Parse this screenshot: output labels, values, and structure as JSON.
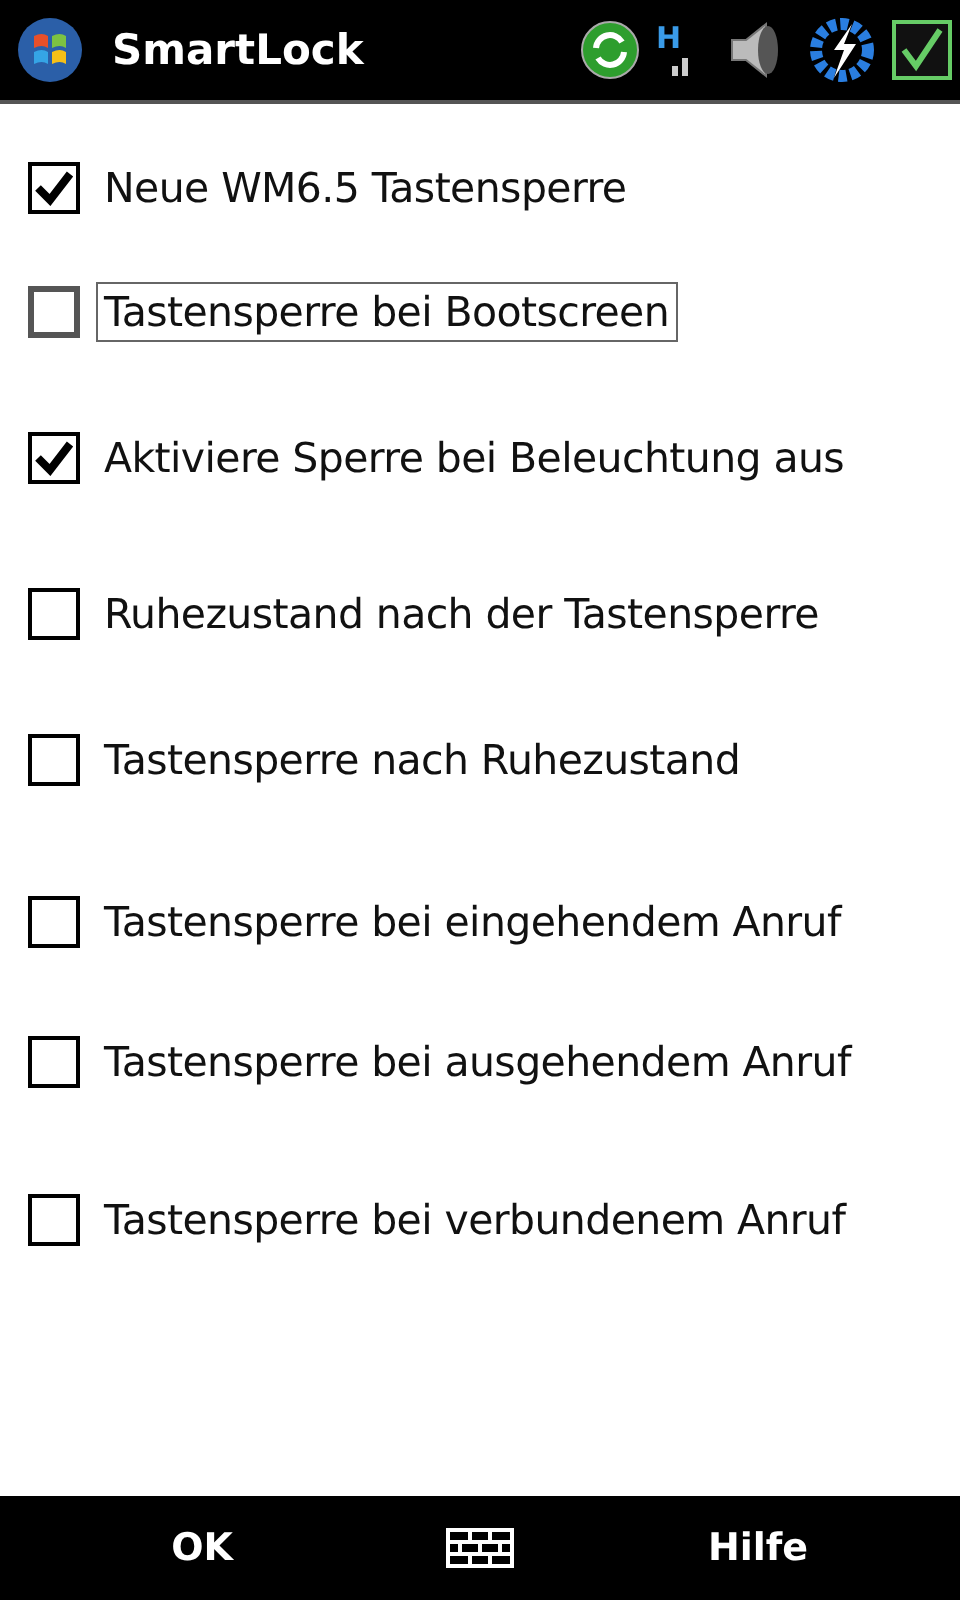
{
  "title_bar": {
    "title": "SmartLock"
  },
  "options": [
    {
      "label": "Neue WM6.5 Tastensperre",
      "checked": true,
      "focused": false
    },
    {
      "label": "Tastensperre bei Bootscreen",
      "checked": false,
      "focused": true
    },
    {
      "label": "Aktiviere Sperre bei Beleuchtung aus",
      "checked": true,
      "focused": false
    },
    {
      "label": "Ruhezustand nach der Tastensperre",
      "checked": false,
      "focused": false
    },
    {
      "label": "Tastensperre nach Ruhezustand",
      "checked": false,
      "focused": false
    },
    {
      "label": "Tastensperre bei eingehendem Anruf",
      "checked": false,
      "focused": false
    },
    {
      "label": "Tastensperre bei ausgehendem Anruf",
      "checked": false,
      "focused": false
    },
    {
      "label": "Tastensperre bei verbundenem Anruf",
      "checked": false,
      "focused": false
    }
  ],
  "status": {
    "network": "H"
  },
  "softkeys": {
    "left": "OK",
    "right": "Hilfe"
  }
}
